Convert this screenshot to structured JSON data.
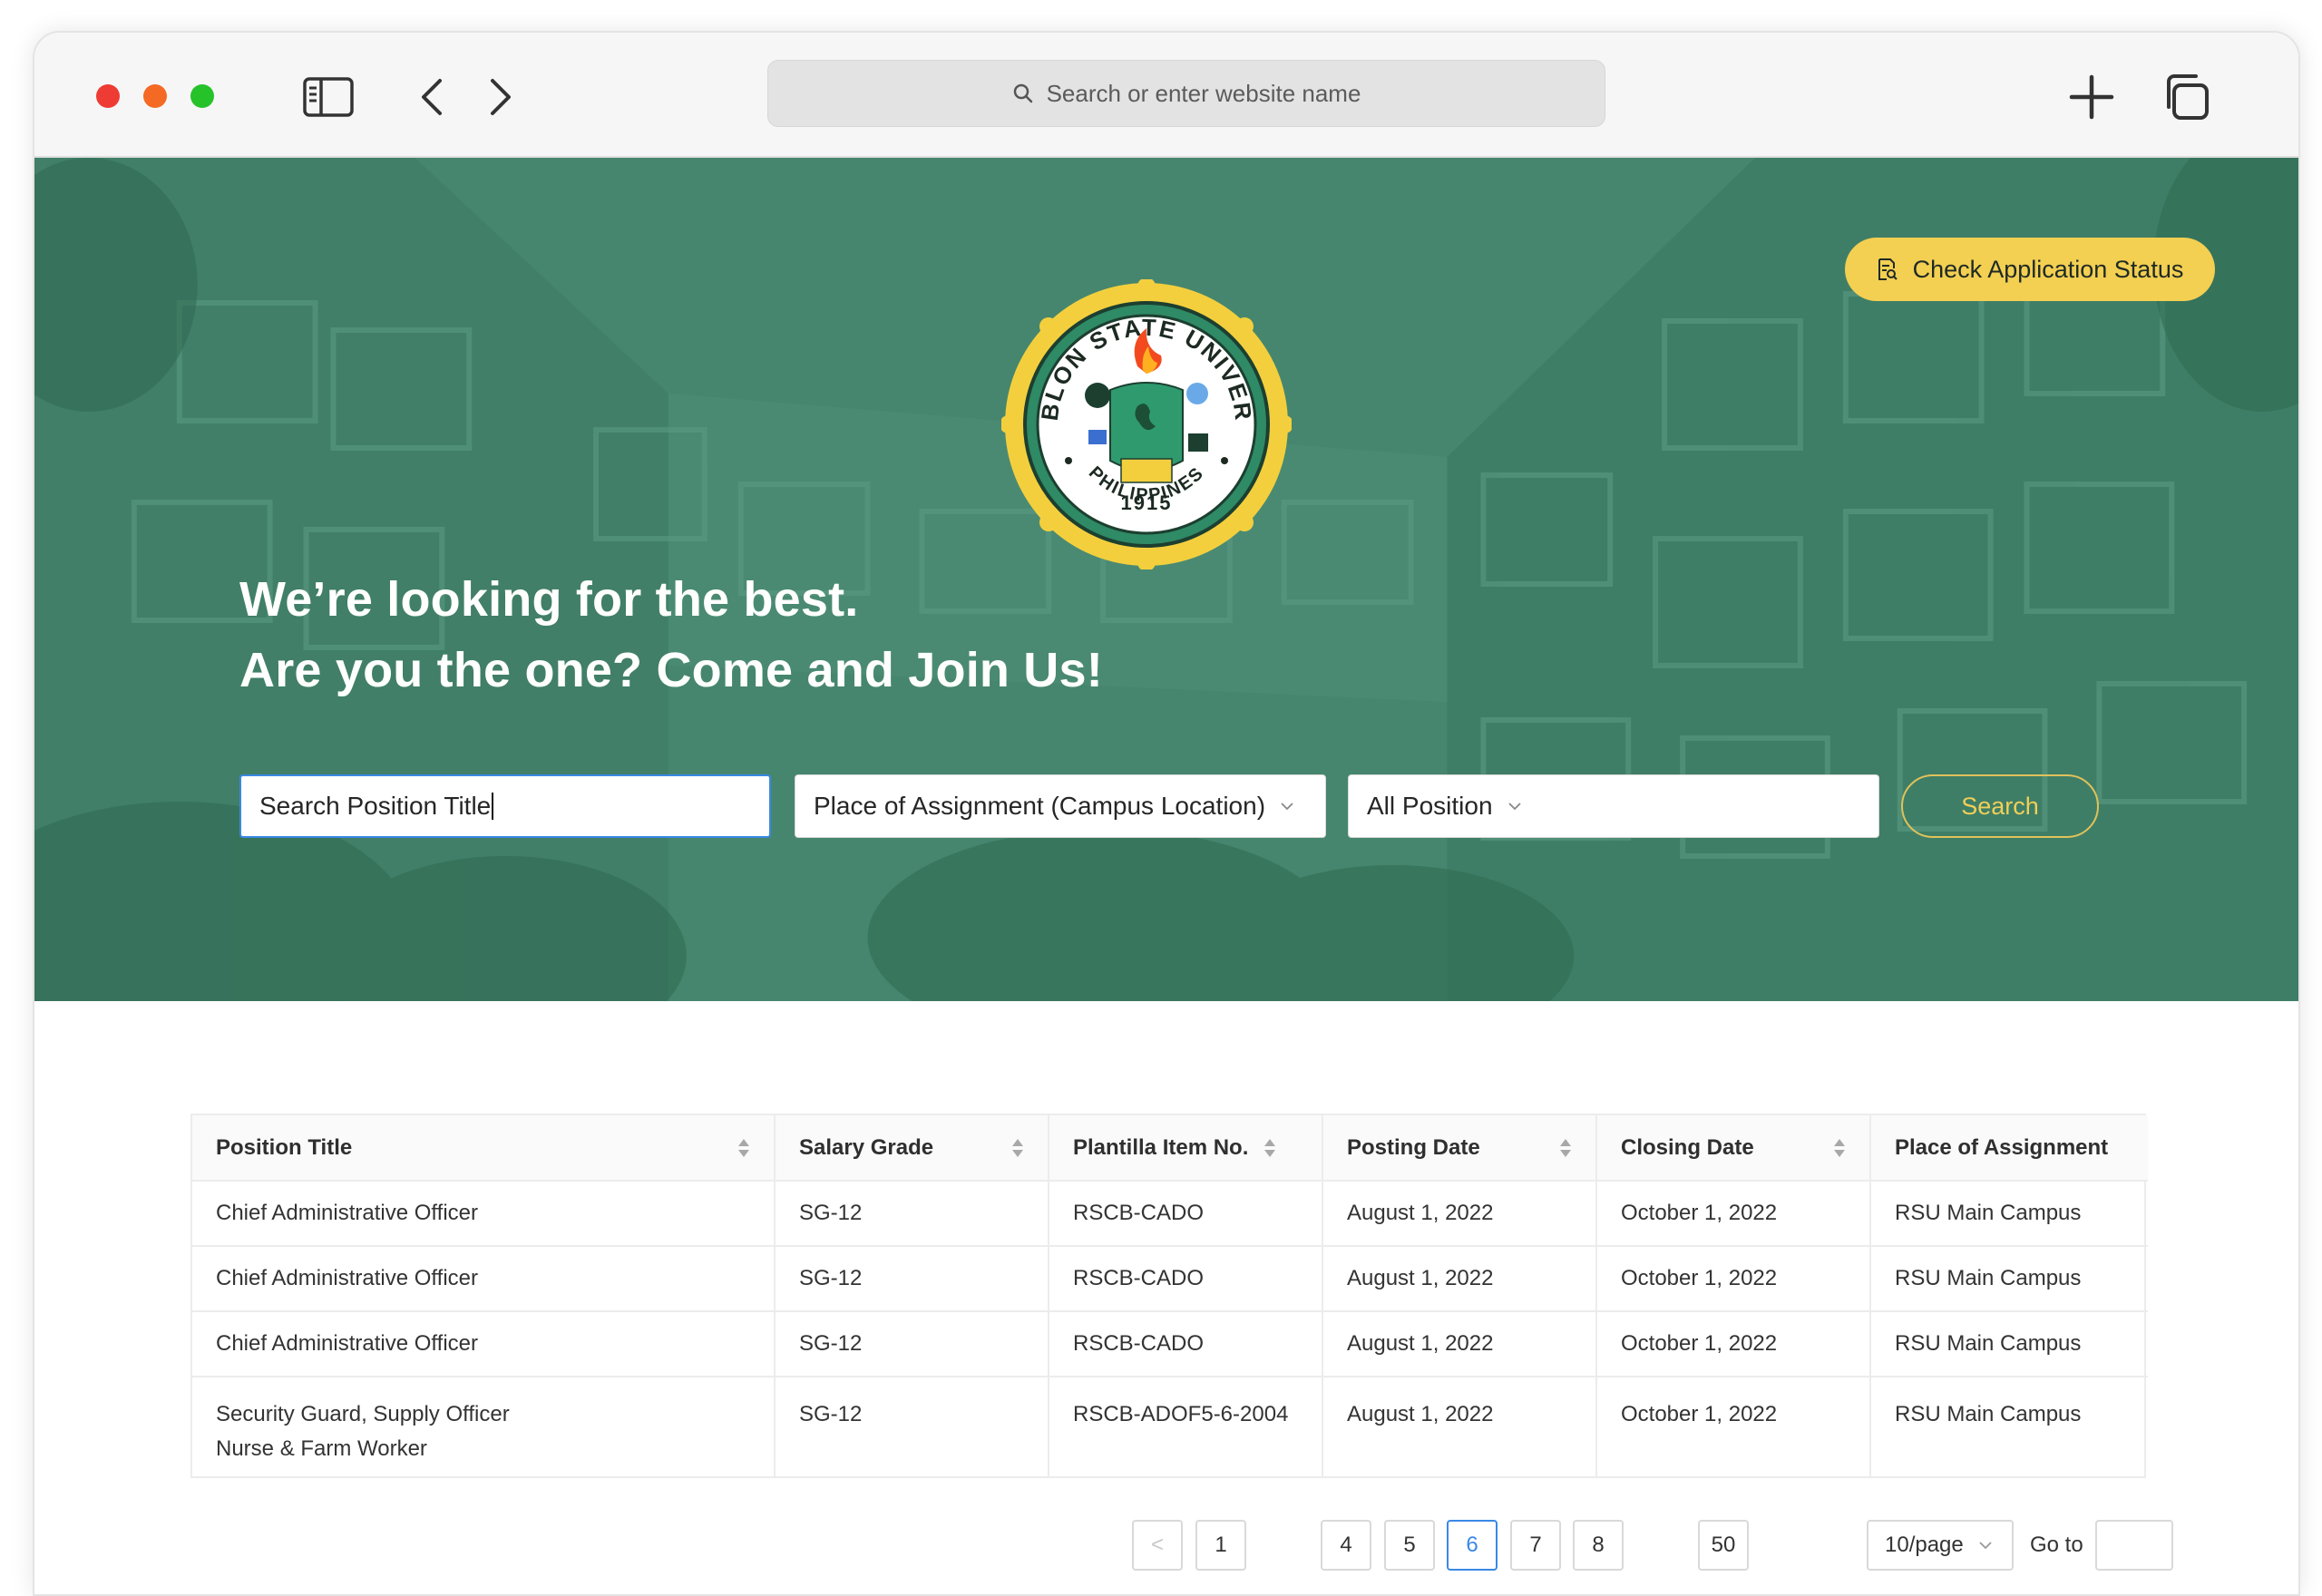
{
  "browser": {
    "address_placeholder": "Search or enter website name"
  },
  "hero": {
    "status_button": "Check Application Status",
    "logo": {
      "top_text": "ROMBLON STATE UNIVERSITY",
      "year": "1915",
      "bottom_text": "PHILIPPINES"
    },
    "headline_line1": "We’re looking for the best.",
    "headline_line2": "Are you the one? Come and Join Us!",
    "search_value": "Search Position Title",
    "place_select": "Place of Assignment (Campus Location)",
    "position_select": "All Position",
    "search_button": "Search"
  },
  "table": {
    "headers": [
      "Position Title",
      "Salary Grade",
      "Plantilla Item No.",
      "Posting Date",
      "Closing Date",
      "Place of Assignment"
    ],
    "rows": [
      {
        "title_line1": "Chief Administrative Officer",
        "title_line2": "",
        "grade": "SG-12",
        "item": "RSCB-CADO",
        "posting": "August 1, 2022",
        "closing": "October 1, 2022",
        "place": "RSU Main Campus"
      },
      {
        "title_line1": "Chief Administrative Officer",
        "title_line2": "",
        "grade": "SG-12",
        "item": "RSCB-CADO",
        "posting": "August 1, 2022",
        "closing": "October 1, 2022",
        "place": "RSU Main Campus"
      },
      {
        "title_line1": "Chief Administrative Officer",
        "title_line2": "",
        "grade": "SG-12",
        "item": "RSCB-CADO",
        "posting": "August 1, 2022",
        "closing": "October 1, 2022",
        "place": "RSU Main Campus"
      },
      {
        "title_line1": "Security Guard, Supply Officer",
        "title_line2": "Nurse & Farm Worker",
        "grade": "SG-12",
        "item": "RSCB-ADOF5-6-2004",
        "posting": "August 1, 2022",
        "closing": "October 1, 2022",
        "place": "RSU Main Campus"
      }
    ]
  },
  "pagination": {
    "prev": "<",
    "pages": [
      "1",
      "4",
      "5",
      "6",
      "7",
      "8",
      "50"
    ],
    "current": "6",
    "page_size": "10/page",
    "goto_label": "Go to"
  },
  "colors": {
    "hero_green": "#46866e",
    "accent_yellow": "#f3cf52",
    "active_blue": "#3a88e6"
  }
}
